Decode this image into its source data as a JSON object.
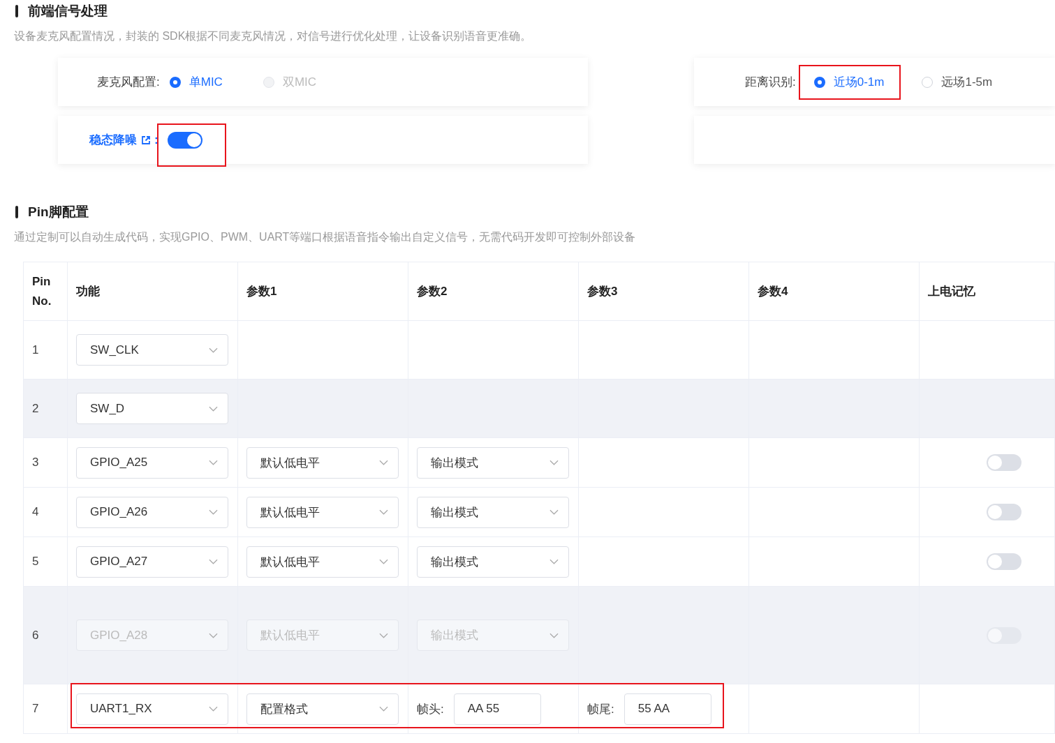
{
  "frontend": {
    "title": "前端信号处理",
    "description": "设备麦克风配置情况，封装的 SDK根据不同麦克风情况，对信号进行优化处理，让设备识别语音更准确。",
    "mic": {
      "label": "麦克风配置:",
      "options": [
        {
          "label": "单MIC",
          "selected": true,
          "disabled": false,
          "highlighted": false
        },
        {
          "label": "双MIC",
          "selected": false,
          "disabled": true,
          "highlighted": false
        }
      ]
    },
    "noise": {
      "label": "稳态降噪",
      "suffix": ":",
      "on": true,
      "highlighted": true
    },
    "distance": {
      "label": "距离识别:",
      "options": [
        {
          "label": "近场0-1m",
          "selected": true,
          "disabled": false,
          "highlighted": true
        },
        {
          "label": "远场1-5m",
          "selected": false,
          "disabled": false,
          "highlighted": false
        }
      ]
    }
  },
  "pins": {
    "title": "Pin脚配置",
    "description": "通过定制可以自动生成代码，实现GPIO、PWM、UART等端口根据语音指令输出自定义信号，无需代码开发即可控制外部设备",
    "columns": [
      "Pin No.",
      "功能",
      "参数1",
      "参数2",
      "参数3",
      "参数4",
      "上电记忆"
    ],
    "rows": [
      {
        "shaded": false,
        "disabled": false,
        "highlighted": false,
        "cells": [
          {
            "kind": "text",
            "value": "1"
          },
          {
            "kind": "select",
            "value": "SW_CLK"
          }
        ]
      },
      {
        "shaded": true,
        "disabled": false,
        "highlighted": false,
        "cells": [
          {
            "kind": "text",
            "value": "2"
          },
          {
            "kind": "select",
            "value": "SW_D"
          }
        ]
      },
      {
        "shaded": false,
        "disabled": false,
        "highlighted": false,
        "cells": [
          {
            "kind": "text",
            "value": "3"
          },
          {
            "kind": "select",
            "value": "GPIO_A25"
          },
          {
            "kind": "select",
            "value": "默认低电平"
          },
          {
            "kind": "select",
            "value": "输出模式"
          }
        ],
        "memory": {
          "on": false
        }
      },
      {
        "shaded": false,
        "disabled": false,
        "highlighted": false,
        "cells": [
          {
            "kind": "text",
            "value": "4"
          },
          {
            "kind": "select",
            "value": "GPIO_A26"
          },
          {
            "kind": "select",
            "value": "默认低电平"
          },
          {
            "kind": "select",
            "value": "输出模式"
          }
        ],
        "memory": {
          "on": false
        }
      },
      {
        "shaded": false,
        "disabled": false,
        "highlighted": false,
        "cells": [
          {
            "kind": "text",
            "value": "5"
          },
          {
            "kind": "select",
            "value": "GPIO_A27"
          },
          {
            "kind": "select",
            "value": "默认低电平"
          },
          {
            "kind": "select",
            "value": "输出模式"
          }
        ],
        "memory": {
          "on": false
        }
      },
      {
        "shaded": true,
        "disabled": true,
        "highlighted": false,
        "cells": [
          {
            "kind": "text",
            "value": "6"
          },
          {
            "kind": "select",
            "value": "GPIO_A28"
          },
          {
            "kind": "select",
            "value": "默认低电平"
          },
          {
            "kind": "select",
            "value": "输出模式"
          }
        ],
        "memory": {
          "on": false
        }
      },
      {
        "shaded": false,
        "disabled": false,
        "highlighted": true,
        "cells": [
          {
            "kind": "text",
            "value": "7"
          },
          {
            "kind": "select",
            "value": "UART1_RX"
          },
          {
            "kind": "select",
            "value": "配置格式"
          },
          {
            "kind": "input",
            "label": "帧头:",
            "value": "AA 55"
          },
          {
            "kind": "input",
            "label": "帧尾:",
            "value": "55 AA"
          }
        ]
      }
    ]
  }
}
